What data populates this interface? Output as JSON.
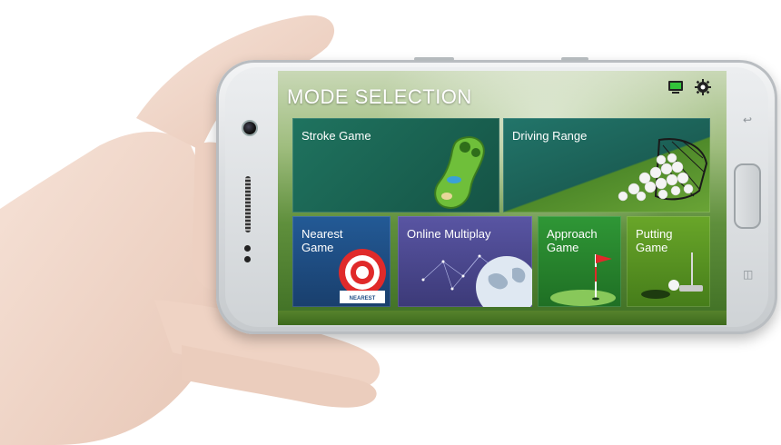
{
  "screen": {
    "title": "MODE SELECTION",
    "top_icons": [
      "monitor-icon",
      "gear-icon"
    ]
  },
  "tiles": [
    {
      "label": "Stroke Game",
      "color": "#1d6b5a",
      "art": "golf-course-map-icon"
    },
    {
      "label": "Driving Range",
      "color": "#1f6f62",
      "art": "golf-ball-basket-icon"
    },
    {
      "label": "Nearest\nGame",
      "color": "#1f4e86",
      "art": "target-icon",
      "art_text": "NEAREST"
    },
    {
      "label": "Online Multiplay",
      "color": "#4f4c93",
      "art": "globe-network-icon"
    },
    {
      "label": "Approach\nGame",
      "color": "#2c8a33",
      "art": "flag-icon"
    },
    {
      "label": "Putting\nGame",
      "color": "#5e9a21",
      "art": "putter-icon"
    }
  ],
  "colors": {
    "accent_green": "#33c43a",
    "tile_border": "#2b2b2b"
  }
}
